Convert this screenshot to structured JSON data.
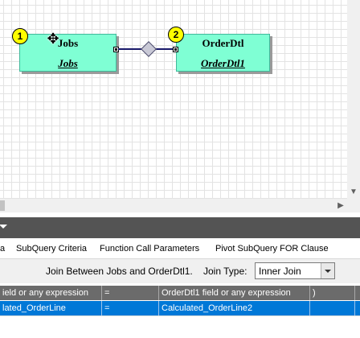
{
  "designer": {
    "tables": [
      {
        "badge": "1",
        "name": "Jobs",
        "alias": "Jobs"
      },
      {
        "badge": "2",
        "name": "OrderDtl",
        "alias": "OrderDtl1"
      }
    ]
  },
  "tabs": [
    "a",
    "SubQuery Criteria",
    "Function Call Parameters",
    "Pivot SubQuery FOR Clause"
  ],
  "join": {
    "description": "Join Between Jobs and OrderDtl1.",
    "type_label": "Join Type:",
    "type_value": "Inner Join"
  },
  "grid": {
    "columns": [
      "ield or any expression",
      "=",
      "OrderDtl1 field or any expression",
      ")"
    ],
    "rows": [
      [
        "lated_OrderLine",
        "=",
        "Calculated_OrderLine2",
        ""
      ]
    ]
  },
  "colors": {
    "table_fill": "#7fffd4",
    "badge_fill": "#ffff00",
    "selection": "#0078d7",
    "header_bar": "#545454"
  }
}
